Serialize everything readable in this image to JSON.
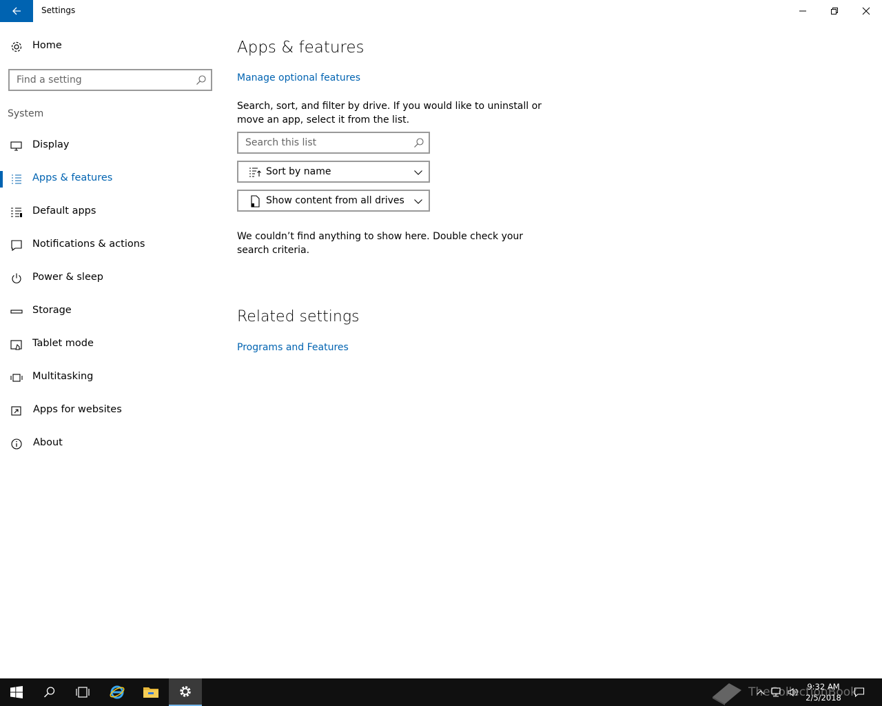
{
  "window": {
    "title": "Settings"
  },
  "sidebar": {
    "home_label": "Home",
    "search_placeholder": "Find a setting",
    "group_label": "System",
    "items": [
      {
        "label": "Display",
        "icon": "monitor-icon"
      },
      {
        "label": "Apps & features",
        "icon": "apps-list-icon",
        "active": true
      },
      {
        "label": "Default apps",
        "icon": "default-apps-icon"
      },
      {
        "label": "Notifications & actions",
        "icon": "notification-icon"
      },
      {
        "label": "Power & sleep",
        "icon": "power-icon"
      },
      {
        "label": "Storage",
        "icon": "storage-icon"
      },
      {
        "label": "Tablet mode",
        "icon": "tablet-icon"
      },
      {
        "label": "Multitasking",
        "icon": "multitasking-icon"
      },
      {
        "label": "Apps for websites",
        "icon": "open-in-app-icon"
      },
      {
        "label": "About",
        "icon": "info-icon"
      }
    ]
  },
  "main": {
    "title": "Apps & features",
    "manage_link": "Manage optional features",
    "description": "Search, sort, and filter by drive. If you would like to uninstall or move an app, select it from the list.",
    "search_placeholder": "Search this list",
    "sort_label": "Sort by name",
    "filter_label": "Show content from all drives",
    "empty_message": "We couldn’t find anything to show here. Double check your search criteria.",
    "related_title": "Related settings",
    "related_link": "Programs and Features"
  },
  "taskbar": {
    "time": "9:32 AM",
    "date": "2/5/2018",
    "watermark": "TheCollectionBook"
  },
  "colors": {
    "accent": "#0063b1",
    "taskbar": "#101010"
  }
}
